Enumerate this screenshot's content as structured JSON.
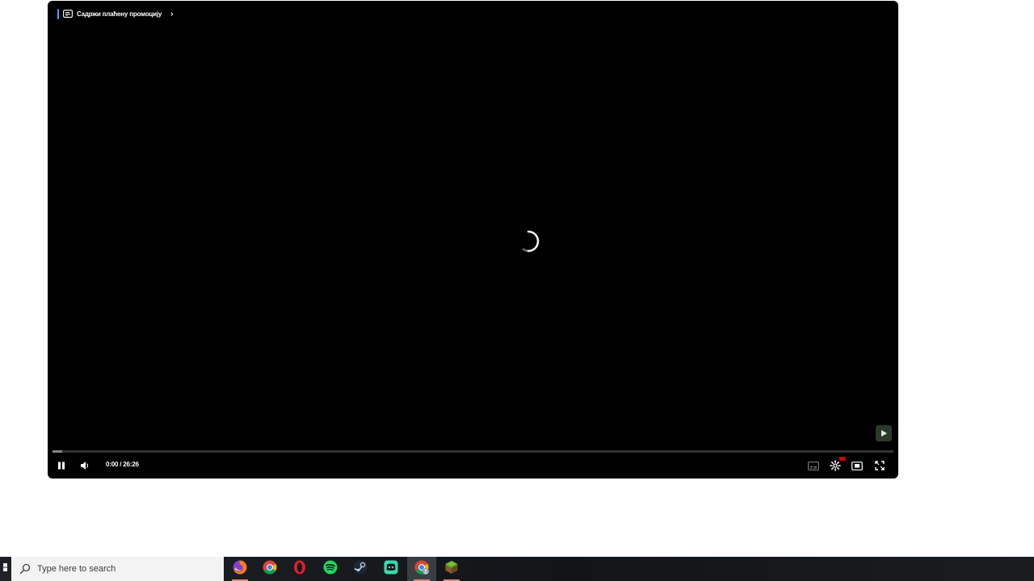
{
  "player": {
    "promo_label": "Садржи плаћену промоцију",
    "promo_chevron": "›",
    "time_current": "0:00",
    "time_separator": " / ",
    "time_duration": "26:26",
    "progress_played_fraction": 0.0,
    "progress_loaded_fraction": 0.012,
    "state": "loading",
    "icons": {
      "promo": "paid-promotion-icon",
      "pause": "pause-icon",
      "volume": "volume-icon",
      "subtitles": "subtitles-icon",
      "settings": "gear-icon",
      "miniplayer": "miniplayer-icon",
      "fullscreen": "fullscreen-icon",
      "watermark": "channel-watermark-icon"
    },
    "colors": {
      "background": "#000000",
      "accent_blue": "#3ea6ff",
      "progress_red": "#ff0000",
      "hd_badge": "#cc0000"
    }
  },
  "taskbar": {
    "search_placeholder": "Type here to search",
    "apps": [
      {
        "name": "Firefox",
        "icon": "firefox-icon",
        "running": true,
        "active": false
      },
      {
        "name": "Google Chrome",
        "icon": "chrome-icon",
        "running": false,
        "active": false
      },
      {
        "name": "Opera",
        "icon": "opera-icon",
        "running": false,
        "active": false
      },
      {
        "name": "Spotify",
        "icon": "spotify-icon",
        "running": false,
        "active": false
      },
      {
        "name": "Steam",
        "icon": "steam-icon",
        "running": false,
        "active": false
      },
      {
        "name": "Discord",
        "icon": "discord-icon",
        "running": false,
        "active": false
      },
      {
        "name": "Google Chrome (profile)",
        "icon": "chrome-profile-icon",
        "running": true,
        "active": true
      },
      {
        "name": "Minecraft",
        "icon": "minecraft-icon",
        "running": true,
        "active": false
      }
    ],
    "colors": {
      "background": "#16191c",
      "search_box": "#f3f3f3",
      "running_indicator": "#d1897a"
    }
  }
}
